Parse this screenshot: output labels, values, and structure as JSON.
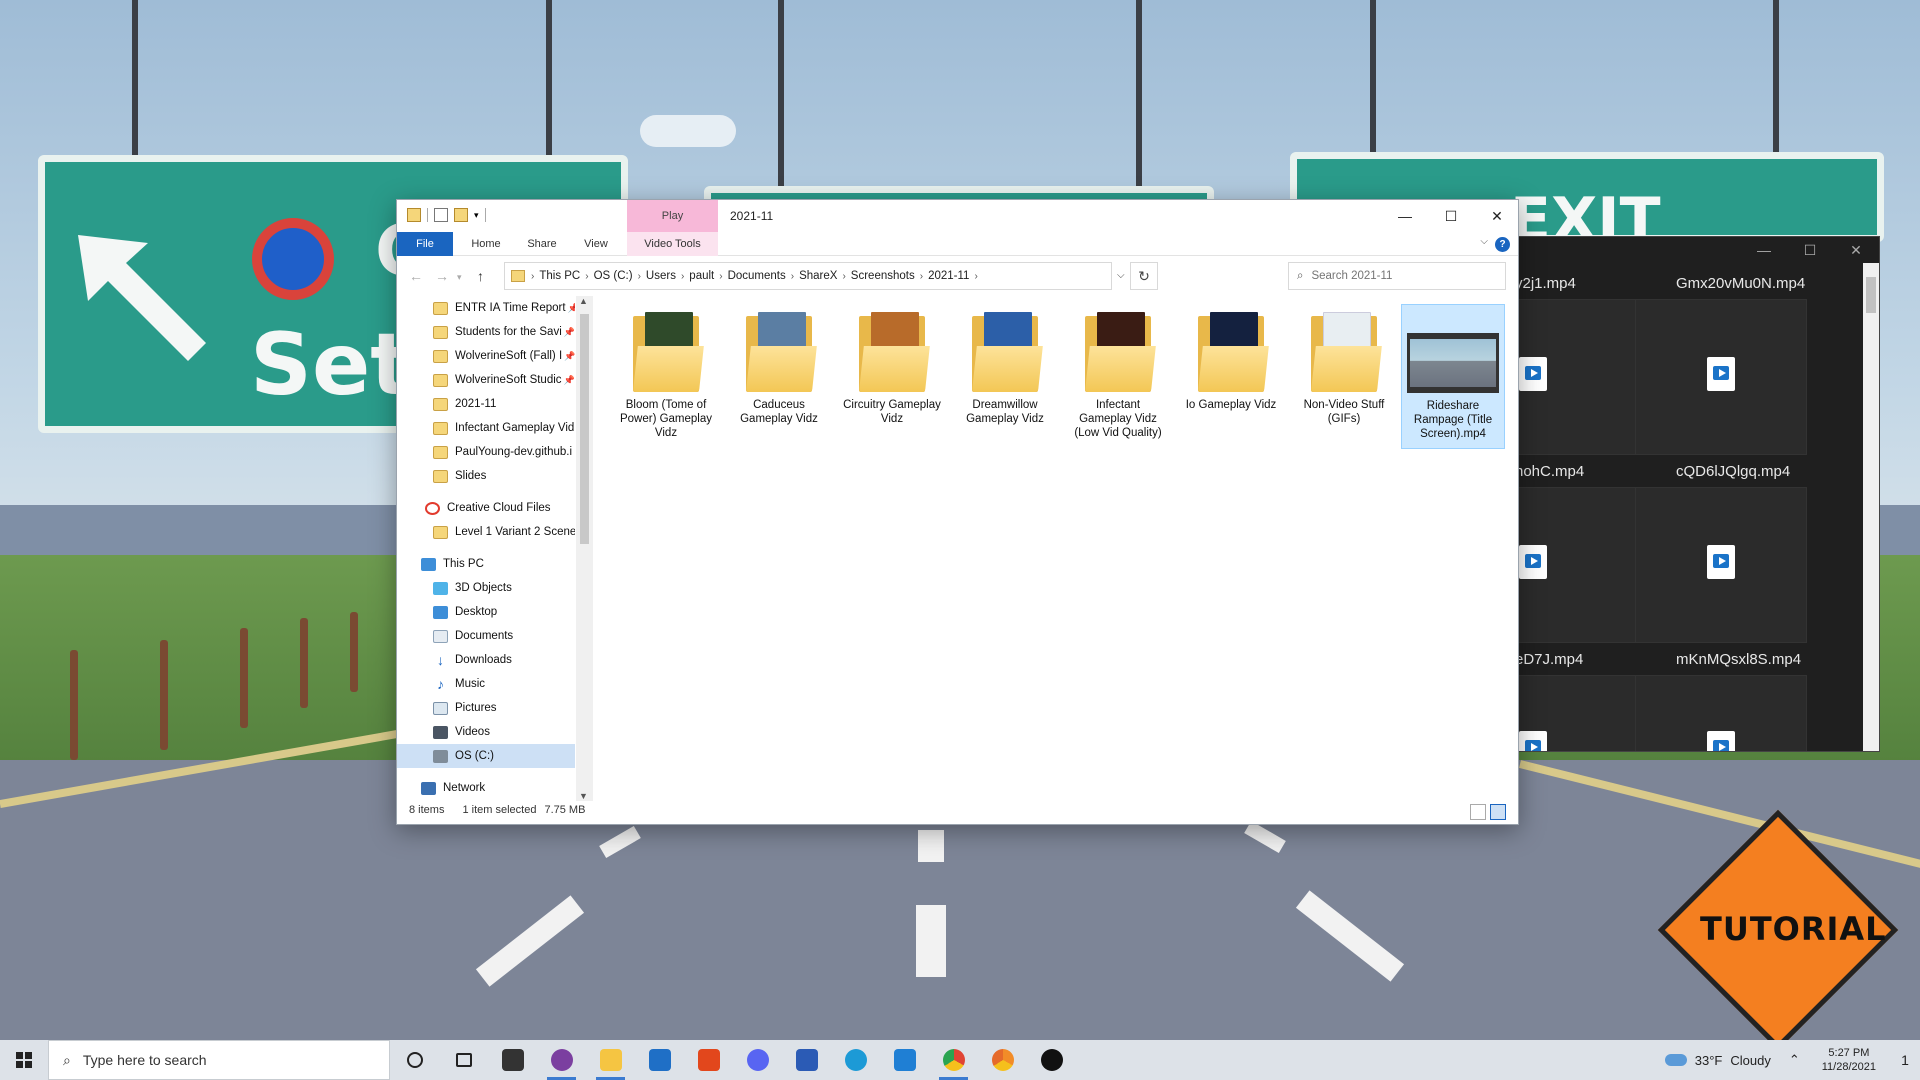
{
  "explorer": {
    "window_title": "2021-11",
    "contextual_tab": "Play",
    "ribbon_tabs": [
      "File",
      "Home",
      "Share",
      "View",
      "Video Tools"
    ],
    "controls": {
      "minimize": "—",
      "maximize": "☐",
      "close": "✕",
      "help": "?"
    },
    "breadcrumb": [
      "This PC",
      "OS (C:)",
      "Users",
      "pault",
      "Documents",
      "ShareX",
      "Screenshots",
      "2021-11"
    ],
    "search_placeholder": "Search 2021-11",
    "nav_items": [
      {
        "label": "ENTR IA Time Report",
        "icon": "folder-icon",
        "pinned": true
      },
      {
        "label": "Students for the Savi",
        "icon": "folder-icon",
        "pinned": true
      },
      {
        "label": "WolverineSoft (Fall) I",
        "icon": "folder-icon",
        "pinned": true
      },
      {
        "label": "WolverineSoft Studic",
        "icon": "folder-icon",
        "pinned": true
      },
      {
        "label": "2021-11",
        "icon": "folder-icon"
      },
      {
        "label": "Infectant Gameplay Vid",
        "icon": "folder-icon"
      },
      {
        "label": "PaulYoung-dev.github.i",
        "icon": "folder-icon"
      },
      {
        "label": "Slides",
        "icon": "folder-icon"
      },
      {
        "label": "Creative Cloud Files",
        "icon": "creative-cloud-icon"
      },
      {
        "label": "Level 1 Variant 2 Scene-",
        "icon": "folder-icon"
      },
      {
        "label": "This PC",
        "icon": "computer-icon"
      },
      {
        "label": "3D Objects",
        "icon": "3d-objects-icon"
      },
      {
        "label": "Desktop",
        "icon": "desktop-icon"
      },
      {
        "label": "Documents",
        "icon": "documents-icon"
      },
      {
        "label": "Downloads",
        "icon": "downloads-icon"
      },
      {
        "label": "Music",
        "icon": "music-icon"
      },
      {
        "label": "Pictures",
        "icon": "pictures-icon"
      },
      {
        "label": "Videos",
        "icon": "videos-icon"
      },
      {
        "label": "OS (C:)",
        "icon": "drive-icon",
        "selected": true
      },
      {
        "label": "Network",
        "icon": "network-icon"
      }
    ],
    "files": [
      {
        "name": "Bloom (Tome of Power) Gameplay Vidz",
        "type": "folder",
        "preview": "#2f4a2a"
      },
      {
        "name": "Caduceus Gameplay Vidz",
        "type": "folder",
        "preview": "#5b7ea3"
      },
      {
        "name": "Circuitry Gameplay Vidz",
        "type": "folder",
        "preview": "#b86b2a"
      },
      {
        "name": "Dreamwillow Gameplay Vidz",
        "type": "folder",
        "preview": "#2c5fa8"
      },
      {
        "name": "Infectant Gameplay Vidz (Low Vid Quality)",
        "type": "folder",
        "preview": "#3a1c14"
      },
      {
        "name": "Io Gameplay Vidz",
        "type": "folder",
        "preview": "#14213f"
      },
      {
        "name": "Non-Video Stuff (GIFs)",
        "type": "folder",
        "preview": "#e8eef2"
      },
      {
        "name": "Rideshare Rampage (Title Screen).mp4",
        "type": "video",
        "selected": true
      }
    ],
    "status": {
      "count": "8 items",
      "selection": "1 item selected",
      "size": "7.75 MB"
    }
  },
  "media_window": {
    "items": [
      "y2j1.mp4",
      "Gmx20vMu0N.mp4",
      "nohC.mp4",
      "cQD6lJQlgq.mp4",
      "eD7J.mp4",
      "mKnMQsxl8S.mp4"
    ]
  },
  "desktop": {
    "sign_text": "TUTORIAL",
    "sign_fragment_left": "Set",
    "sign_fragment_left_top": "C",
    "sign_fragment_right": "EXIT"
  },
  "taskbar": {
    "search_placeholder": "Type here to search",
    "apps": [
      "task-view-icon",
      "store-icon",
      "github-desktop-icon",
      "file-explorer-icon",
      "mail-icon",
      "office-icon",
      "discord-icon",
      "word-icon",
      "edge-icon",
      "vscode-icon",
      "chrome-icon",
      "chrome-canary-icon",
      "unreal-engine-icon"
    ],
    "weather": {
      "temp": "33°F",
      "condition": "Cloudy"
    },
    "time": "5:27 PM",
    "date": "11/28/2021",
    "notifications": "1"
  }
}
